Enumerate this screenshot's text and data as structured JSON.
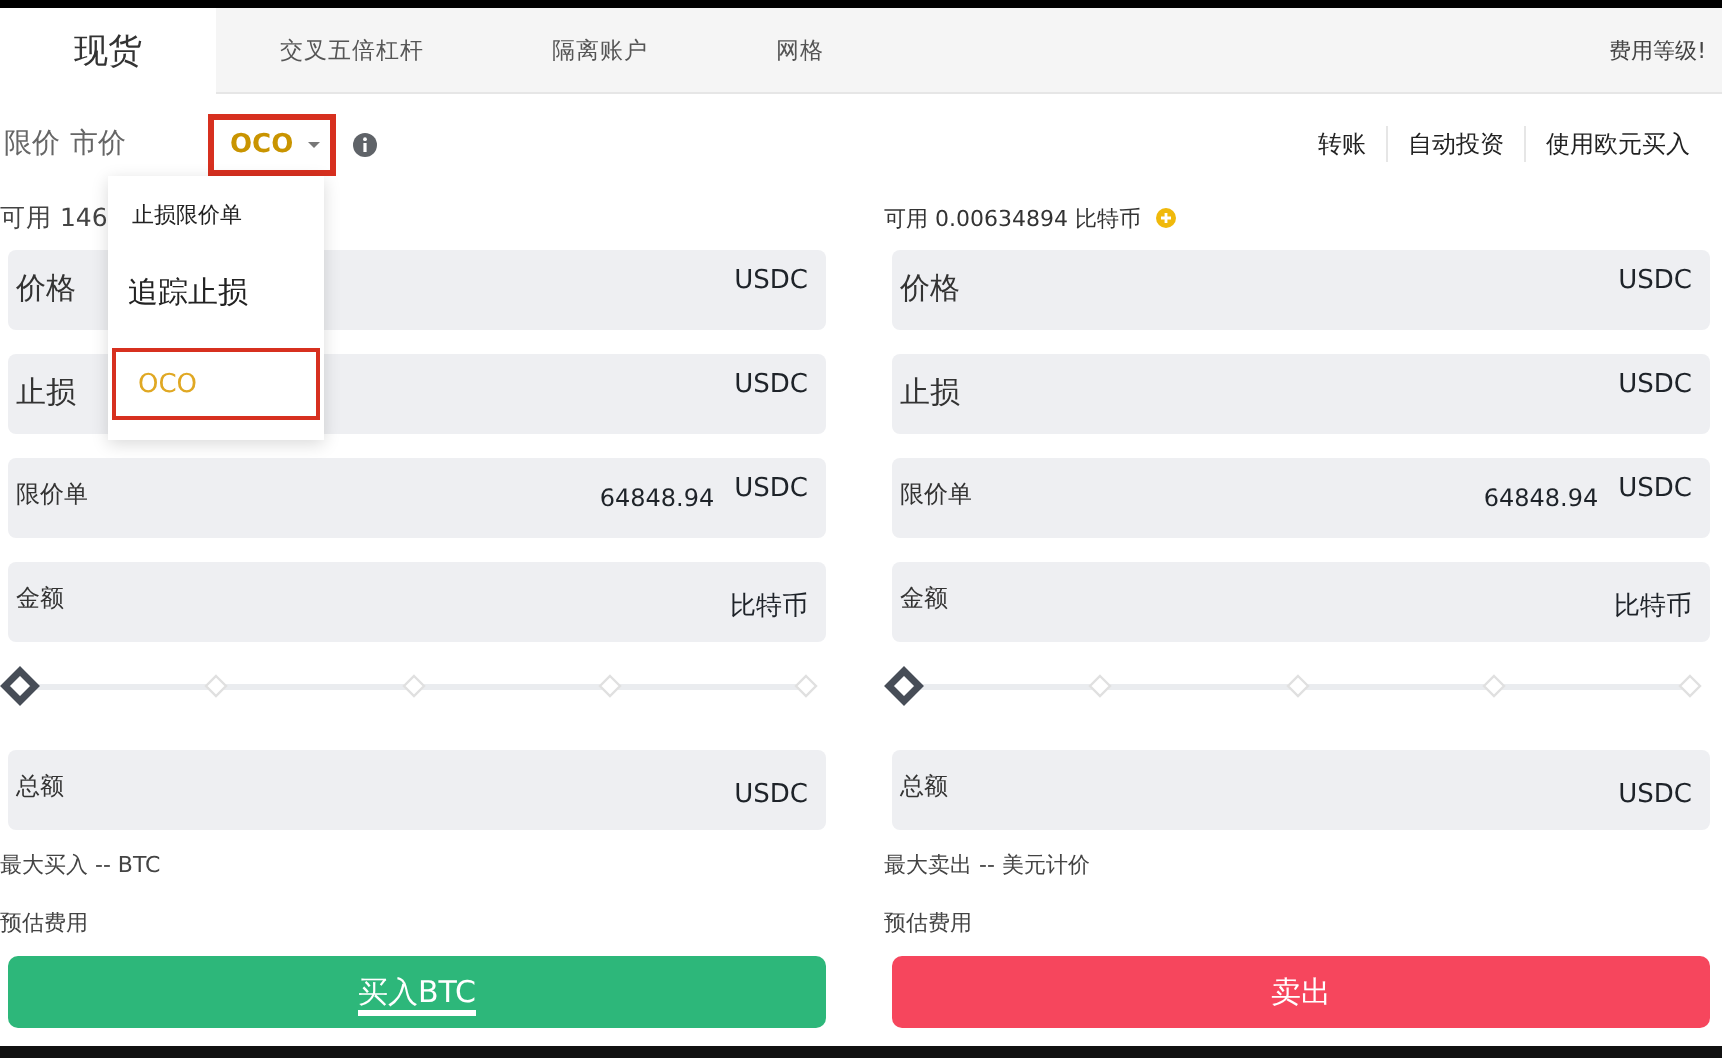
{
  "tabs": [
    {
      "label": "现货",
      "selected": true
    },
    {
      "label": "交叉五倍杠杆",
      "selected": false
    },
    {
      "label": "隔离账户",
      "selected": false
    },
    {
      "label": "网格",
      "selected": false
    }
  ],
  "fee_link": "费用等级!",
  "order_types": [
    {
      "label": "限价",
      "selected": false
    },
    {
      "label": "市价",
      "selected": false
    }
  ],
  "order_type_dropdown": {
    "value": "OCO",
    "expanded": true,
    "highlighted": true,
    "options": [
      {
        "label": "止损限价单",
        "selected": false,
        "highlighted": false
      },
      {
        "label": "追踪止损",
        "selected": false,
        "highlighted": false
      },
      {
        "label": "OCO",
        "selected": true,
        "highlighted": true
      }
    ]
  },
  "links": [
    "转账",
    "自动投资",
    "使用欧元买入"
  ],
  "panels": [
    {
      "kind": "buy",
      "available": "可用 146",
      "fields": [
        {
          "kind": "prominent",
          "label": "价格",
          "unit": "USDC"
        },
        {
          "kind": "prominent",
          "label": "止损",
          "unit": "USDC"
        },
        {
          "kind": "plain",
          "label": "限价单",
          "value": "64848.94",
          "unit": "USDC"
        },
        {
          "kind": "plain",
          "label": "金额",
          "unit": "比特币"
        }
      ],
      "slider": {
        "level": 0
      },
      "total": {
        "kind": "plain",
        "label": "总额",
        "unit": "USDC"
      },
      "max_text": "最大买入 -- BTC",
      "fee_label": "预估费用",
      "button": {
        "label": "买入BTC",
        "focused": true
      }
    },
    {
      "kind": "sell",
      "available": "可用 0.00634894 比特币",
      "fields": [
        {
          "kind": "prominent",
          "label": "价格",
          "unit": "USDC"
        },
        {
          "kind": "prominent",
          "label": "止损",
          "unit": "USDC"
        },
        {
          "kind": "plain",
          "label": "限价单",
          "value": "64848.94",
          "unit": "USDC"
        },
        {
          "kind": "plain",
          "label": "金额",
          "unit": "比特币"
        }
      ],
      "slider": {
        "level": 0
      },
      "total": {
        "kind": "plain",
        "label": "总额",
        "unit": "USDC"
      },
      "max_text": "最大卖出 -- 美元计价",
      "fee_label": "预估费用",
      "button": {
        "label": "卖出",
        "focused": false
      }
    }
  ]
}
